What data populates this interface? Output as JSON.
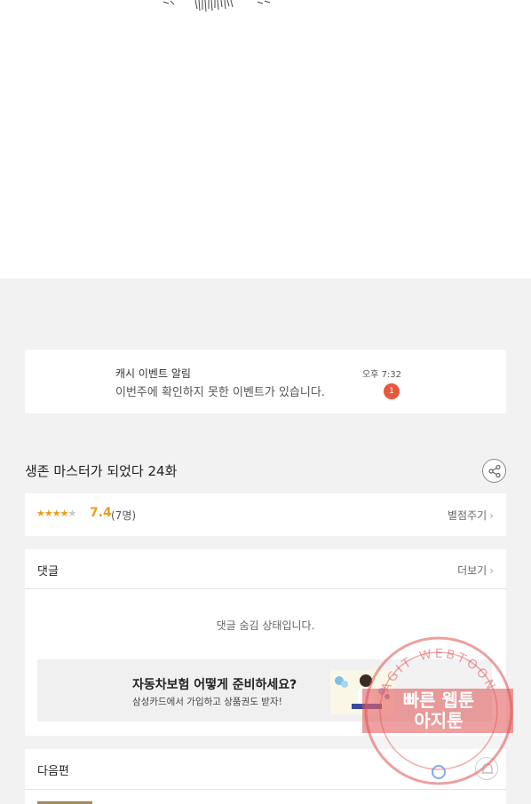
{
  "notification": {
    "title": "캐시 이벤트 알림",
    "message": "이번주에 확인하지 못한 이벤트가 있습니다.",
    "time": "오후 7:32",
    "badge": "1"
  },
  "episode": {
    "title": "생존 마스터가 되었다 24화"
  },
  "rating": {
    "stars_filled": 3.5,
    "stars_total": 5,
    "score": "7.4",
    "count": "(7명)",
    "rate_link": "별점주기"
  },
  "comments": {
    "label": "댓글",
    "more": "더보기",
    "hidden_message": "댓글 숨김 상태입니다."
  },
  "ad": {
    "title": "자동차보험 어떻게 준비하세요?",
    "subtitle": "삼성카드에서 가입하고 상품권도 받자!"
  },
  "next_episode": {
    "label": "다음편"
  },
  "watermark": {
    "ring_text": "AGIT WEBTOON",
    "main_line1": "빠른 웹툰",
    "main_line2": "아지툰"
  },
  "colors": {
    "accent_orange": "#f09a1a",
    "badge_red": "#e8573d",
    "stamp_red": "#e05050"
  }
}
